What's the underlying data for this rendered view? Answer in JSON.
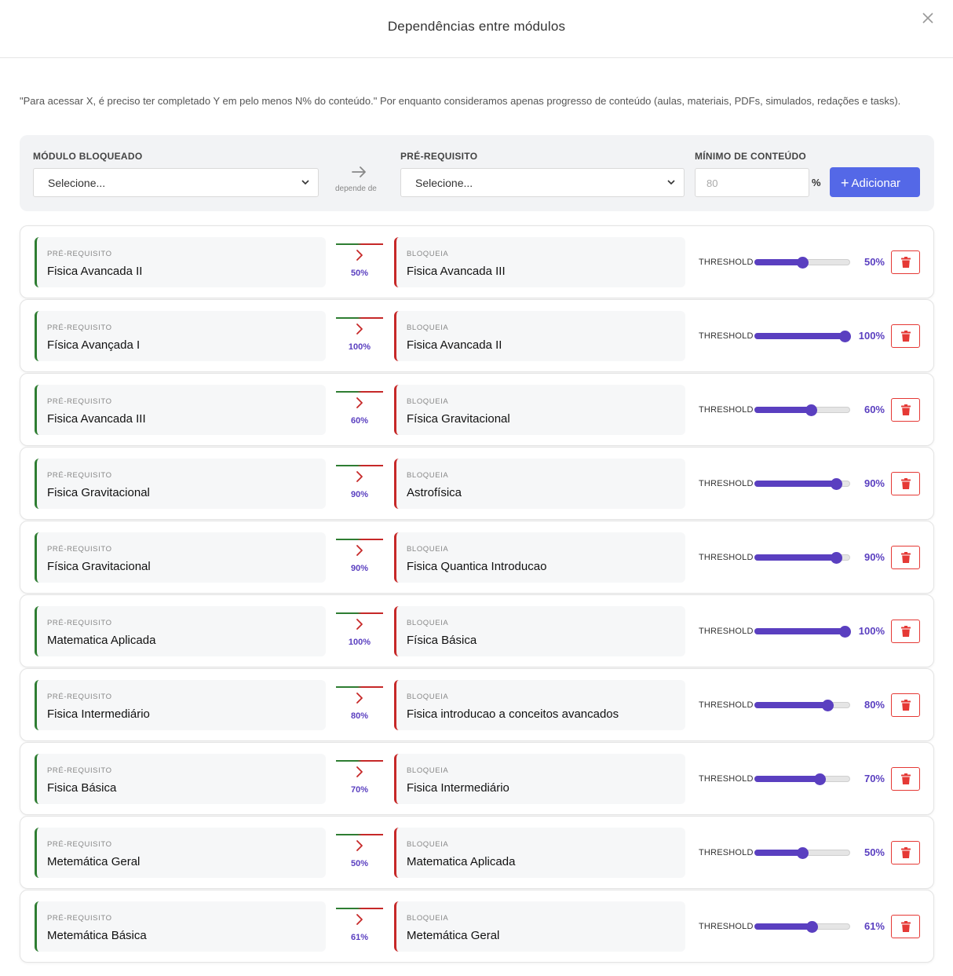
{
  "modal": {
    "title": "Dependências entre módulos",
    "close_icon": "close-icon"
  },
  "description": "\"Para acessar X, é preciso ter completado Y em pelo menos N% do conteúdo.\" Por enquanto consideramos apenas progresso de conteúdo (aulas, materiais, PDFs, simulados, redações e tasks).",
  "form": {
    "blocked_label": "MÓDULO BLOQUEADO",
    "blocked_value": "Selecione...",
    "depends_text": "depende de",
    "prereq_label": "PRÉ-REQUISITO",
    "prereq_value": "Selecione...",
    "min_label": "MÍNIMO DE CONTEÚDO",
    "min_placeholder": "80",
    "pct_sign": "%",
    "add_label": "Adicionar",
    "add_plus": "+"
  },
  "labels": {
    "prereq": "PRÉ-REQUISITO",
    "blocks": "BLOQUEIA",
    "threshold": "THRESHOLD"
  },
  "colors": {
    "accent": "#5a3fc0",
    "button": "#5468e7",
    "prereq_border": "#2e7d32",
    "blocks_border": "#c62828",
    "delete": "#e53935"
  },
  "dependencies": [
    {
      "prereq": "Fisica Avancada II",
      "blocks": "Fisica Avancada III",
      "threshold": 50,
      "threshold_text": "50%"
    },
    {
      "prereq": "Física Avançada I",
      "blocks": "Fisica Avancada II",
      "threshold": 100,
      "threshold_text": "100%"
    },
    {
      "prereq": "Fisica Avancada III",
      "blocks": "Física Gravitacional",
      "threshold": 60,
      "threshold_text": "60%"
    },
    {
      "prereq": "Fisica Gravitacional",
      "blocks": "Astrofísica",
      "threshold": 90,
      "threshold_text": "90%"
    },
    {
      "prereq": "Física Gravitacional",
      "blocks": "Fisica Quantica Introducao",
      "threshold": 90,
      "threshold_text": "90%"
    },
    {
      "prereq": "Matematica Aplicada",
      "blocks": "Física Básica",
      "threshold": 100,
      "threshold_text": "100%"
    },
    {
      "prereq": "Fisica Intermediário",
      "blocks": "Fisica introducao a conceitos avancados",
      "threshold": 80,
      "threshold_text": "80%"
    },
    {
      "prereq": "Fisica Básica",
      "blocks": "Fisica Intermediário",
      "threshold": 70,
      "threshold_text": "70%"
    },
    {
      "prereq": "Metemática Geral",
      "blocks": "Matematica Aplicada",
      "threshold": 50,
      "threshold_text": "50%"
    },
    {
      "prereq": "Metemática Básica",
      "blocks": "Metemática Geral",
      "threshold": 61,
      "threshold_text": "61%"
    }
  ]
}
